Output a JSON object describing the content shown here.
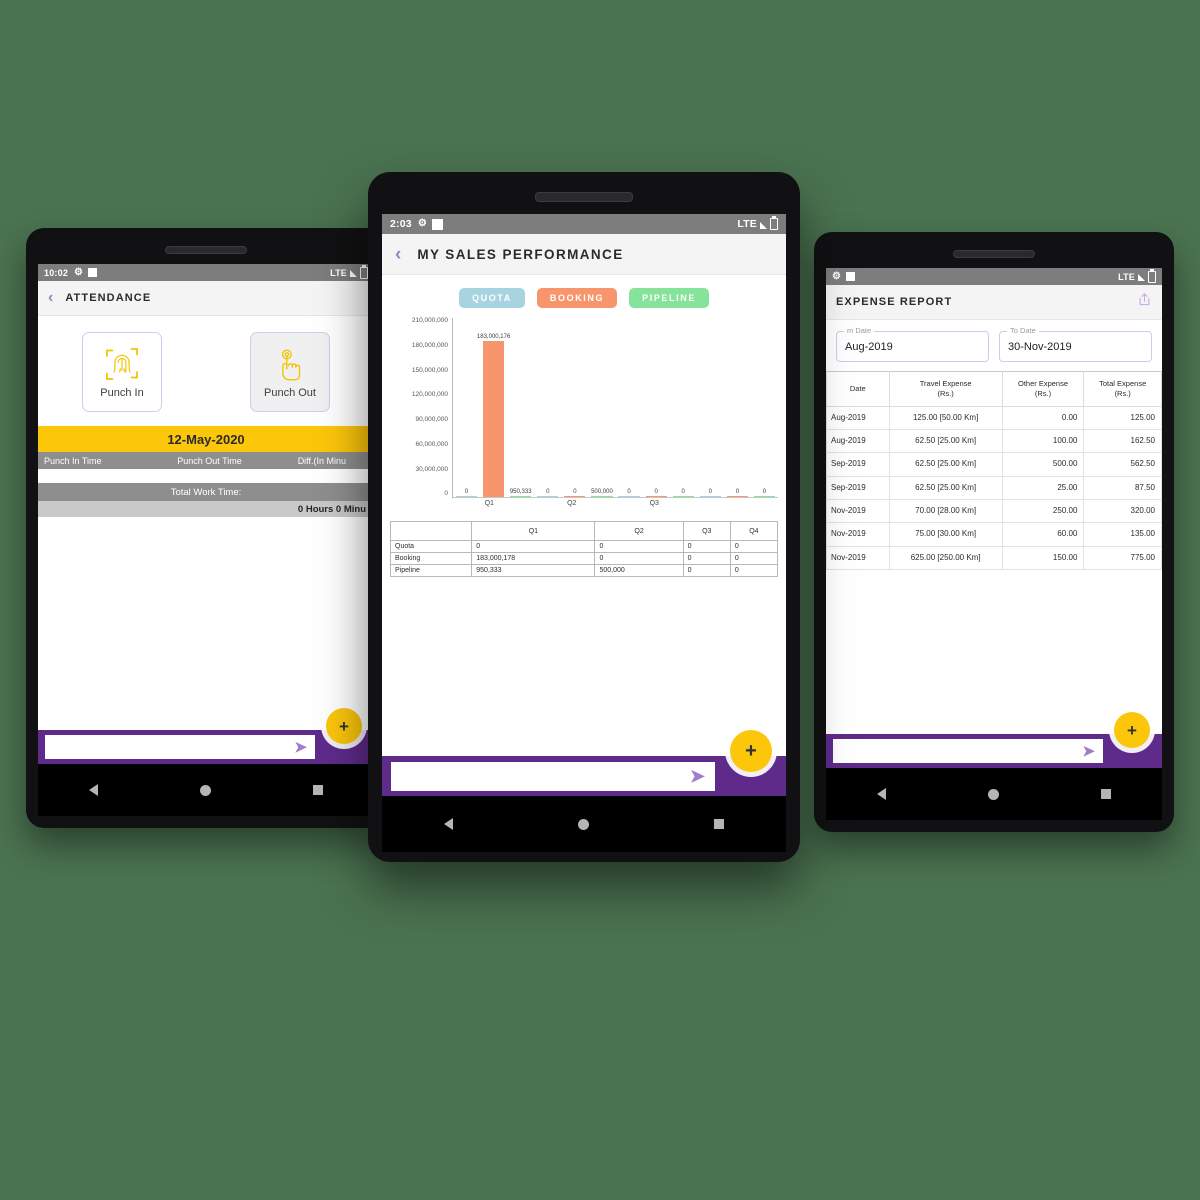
{
  "background_color": "#4a7350",
  "accent_purple": "#5f2b8b",
  "accent_yellow": "#fcc60b",
  "devices": [
    {
      "id": "attendance",
      "statusbar": {
        "time": "10:02",
        "gear_icon": "gear-icon",
        "square_icon": "square-icon",
        "network": "LTE",
        "signal_icon": "signal-icon",
        "battery_icon": "battery-icon"
      },
      "appbar": {
        "back_icon": "chevron-left-icon",
        "title": "ATTENDANCE"
      },
      "punch": {
        "in": {
          "label": "Punch In",
          "icon": "fingerprint-scan-icon"
        },
        "out": {
          "label": "Punch Out",
          "icon": "hand-tap-icon"
        }
      },
      "date_bar": "12-May-2020",
      "table_headers": [
        "Punch In Time",
        "Punch Out Time",
        "Diff.(In Minu"
      ],
      "total_label": "Total Work Time:",
      "total_value": "0 Hours 0 Minu",
      "bottombar": {
        "chat_placeholder": "",
        "send_icon": "send-arrow-icon"
      },
      "fab": {
        "label": "+",
        "name": "add-fab"
      },
      "nav": {
        "back": "nav-back-icon",
        "home": "nav-home-icon",
        "recent": "nav-recent-icon"
      }
    },
    {
      "id": "sales",
      "statusbar": {
        "time": "2:03",
        "gear_icon": "gear-icon",
        "square_icon": "square-icon",
        "network": "LTE",
        "signal_icon": "signal-icon",
        "battery_icon": "battery-icon"
      },
      "appbar": {
        "back_icon": "chevron-left-icon",
        "title": "MY SALES PERFORMANCE"
      },
      "legend": [
        {
          "label": "QUOTA",
          "color": "#a8d3e0"
        },
        {
          "label": "BOOKING",
          "color": "#f7966d"
        },
        {
          "label": "PIPELINE",
          "color": "#86e39a"
        }
      ],
      "bottombar": {
        "chat_placeholder": "",
        "send_icon": "send-arrow-icon"
      },
      "fab": {
        "label": "+",
        "name": "add-fab"
      },
      "nav": {
        "back": "nav-back-icon",
        "home": "nav-home-icon",
        "recent": "nav-recent-icon"
      }
    },
    {
      "id": "expense",
      "statusbar": {
        "time": "",
        "gear_icon": "gear-icon",
        "square_icon": "square-icon",
        "network": "LTE",
        "signal_icon": "signal-icon",
        "battery_icon": "battery-icon"
      },
      "appbar": {
        "back_icon": "",
        "title": "EXPENSE REPORT",
        "share_icon": "share-icon"
      },
      "filters": [
        {
          "label": "m Date",
          "value": "Aug-2019",
          "name": "from-date-field"
        },
        {
          "label": "To Date",
          "value": "30-Nov-2019",
          "name": "to-date-field"
        }
      ],
      "table": {
        "headers": [
          "Date",
          "Travel Expense\n(Rs.)",
          "Other Expense\n(Rs.)",
          "Total Expense\n(Rs.)"
        ],
        "header_lines": [
          [
            "Date",
            ""
          ],
          [
            "Travel Expense",
            "(Rs.)"
          ],
          [
            "Other Expense",
            "(Rs.)"
          ],
          [
            "Total Expense",
            "(Rs.)"
          ]
        ],
        "rows": [
          [
            "Aug-2019",
            "125.00 [50.00 Km]",
            "0.00",
            "125.00"
          ],
          [
            "Aug-2019",
            "62.50 [25.00 Km]",
            "100.00",
            "162.50"
          ],
          [
            "Sep-2019",
            "62.50 [25.00 Km]",
            "500.00",
            "562.50"
          ],
          [
            "Sep-2019",
            "62.50 [25.00 Km]",
            "25.00",
            "87.50"
          ],
          [
            "Nov-2019",
            "70.00 [28.00 Km]",
            "250.00",
            "320.00"
          ],
          [
            "Nov-2019",
            "75.00 [30.00 Km]",
            "60.00",
            "135.00"
          ],
          [
            "Nov-2019",
            "625.00 [250.00 Km]",
            "150.00",
            "775.00"
          ]
        ]
      },
      "bottombar": {
        "chat_placeholder": "",
        "send_icon": "send-arrow-icon"
      },
      "fab": {
        "label": "+",
        "name": "add-fab"
      },
      "nav": {
        "back": "nav-back-icon",
        "home": "nav-home-icon",
        "recent": "nav-recent-icon"
      }
    }
  ],
  "chart_data": {
    "type": "bar",
    "title": "MY SALES PERFORMANCE",
    "xlabel": "",
    "ylabel": "",
    "categories": [
      "Q1",
      "Q2",
      "Q3",
      "Q4"
    ],
    "visible_categories": [
      "Q1",
      "Q2",
      "Q3"
    ],
    "series": [
      {
        "name": "Quota",
        "color": "#a8d3e0",
        "values": [
          0,
          0,
          0,
          0
        ],
        "labels": [
          "0",
          "0",
          "0",
          "0"
        ]
      },
      {
        "name": "Booking",
        "color": "#f7966d",
        "values": [
          183000176,
          0,
          0,
          0
        ],
        "labels": [
          "183,000,176",
          "0",
          "0",
          "0"
        ]
      },
      {
        "name": "Pipeline",
        "color": "#86e39a",
        "values": [
          950333,
          500000,
          0,
          0
        ],
        "labels": [
          "950,333",
          "500,000",
          "0",
          "0"
        ]
      }
    ],
    "ylim": [
      0,
      210000000
    ],
    "yticks": [
      210000000,
      180000000,
      150000000,
      120000000,
      90000000,
      60000000,
      30000000,
      0
    ],
    "ytick_labels": [
      "210,000,000",
      "180,000,000",
      "150,000,000",
      "120,000,000",
      "90,000,000",
      "60,000,000",
      "30,000,000",
      "0"
    ],
    "grid": false,
    "legend_position": "top",
    "table": {
      "columns": [
        "",
        "Q1",
        "Q2",
        "Q3",
        "Q4"
      ],
      "rows": [
        [
          "Quota",
          "0",
          "0",
          "0",
          "0"
        ],
        [
          "Booking",
          "183,000,178",
          "0",
          "0",
          "0"
        ],
        [
          "Pipeline",
          "950,333",
          "500,000",
          "0",
          "0"
        ]
      ]
    }
  }
}
